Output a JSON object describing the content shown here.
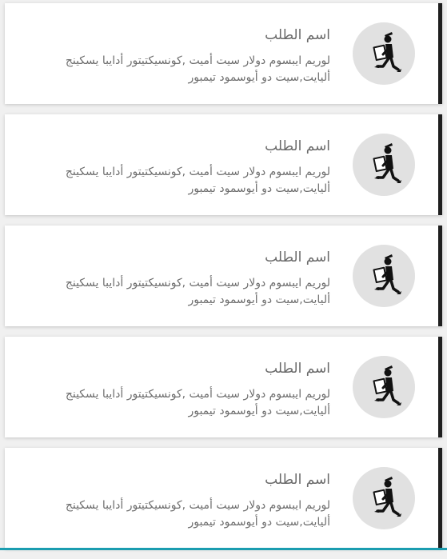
{
  "requests": {
    "items": [
      {
        "title": "اسم الطلب",
        "description": "لوريم ايبسوم دولار سيت أميت ,كونسيكتيتور أدايبا يسكينج أليايت,سيت دو أيوسمود تيمبور",
        "icon": "delivery-person-icon"
      },
      {
        "title": "اسم الطلب",
        "description": "لوريم ايبسوم دولار سيت أميت ,كونسيكتيتور أدايبا يسكينج أليايت,سيت دو أيوسمود تيمبور",
        "icon": "delivery-person-icon"
      },
      {
        "title": "اسم الطلب",
        "description": "لوريم ايبسوم دولار سيت أميت ,كونسيكتيتور أدايبا يسكينج أليايت,سيت دو أيوسمود تيمبور",
        "icon": "delivery-person-icon"
      },
      {
        "title": "اسم الطلب",
        "description": "لوريم ايبسوم دولار سيت أميت ,كونسيكتيتور أدايبا يسكينج أليايت,سيت دو أيوسمود تيمبور",
        "icon": "delivery-person-icon"
      },
      {
        "title": "اسم الطلب",
        "description": "لوريم ايبسوم دولار سيت أميت ,كونسيكتيتور أدايبا يسكينج أليايت,سيت دو أيوسمود تيمبور",
        "icon": "delivery-person-icon"
      }
    ]
  },
  "colors": {
    "card_background": "#ffffff",
    "accent_border": "#1f1f1f",
    "avatar_background": "#e1e1e1",
    "text": "#6a6a6a",
    "bottom_strip": "#1b9db0"
  }
}
